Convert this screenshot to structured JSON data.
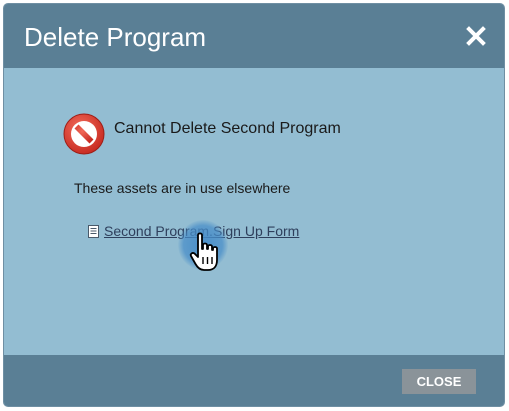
{
  "dialog": {
    "title": "Delete Program",
    "close_icon": "close-x-icon"
  },
  "body": {
    "error_icon": "prohibited-icon",
    "error_message": "Cannot Delete Second Program",
    "assets_text": "These assets are in use elsewhere",
    "assets": [
      {
        "icon": "form-document-icon",
        "label": "Second Program.Sign Up Form"
      }
    ]
  },
  "footer": {
    "close_label": "CLOSE"
  },
  "colors": {
    "header": "#5a7f95",
    "body": "#93bdd2",
    "footer": "#5a7f95",
    "close_button": "#8a9399",
    "error_red": "#d9342b"
  }
}
